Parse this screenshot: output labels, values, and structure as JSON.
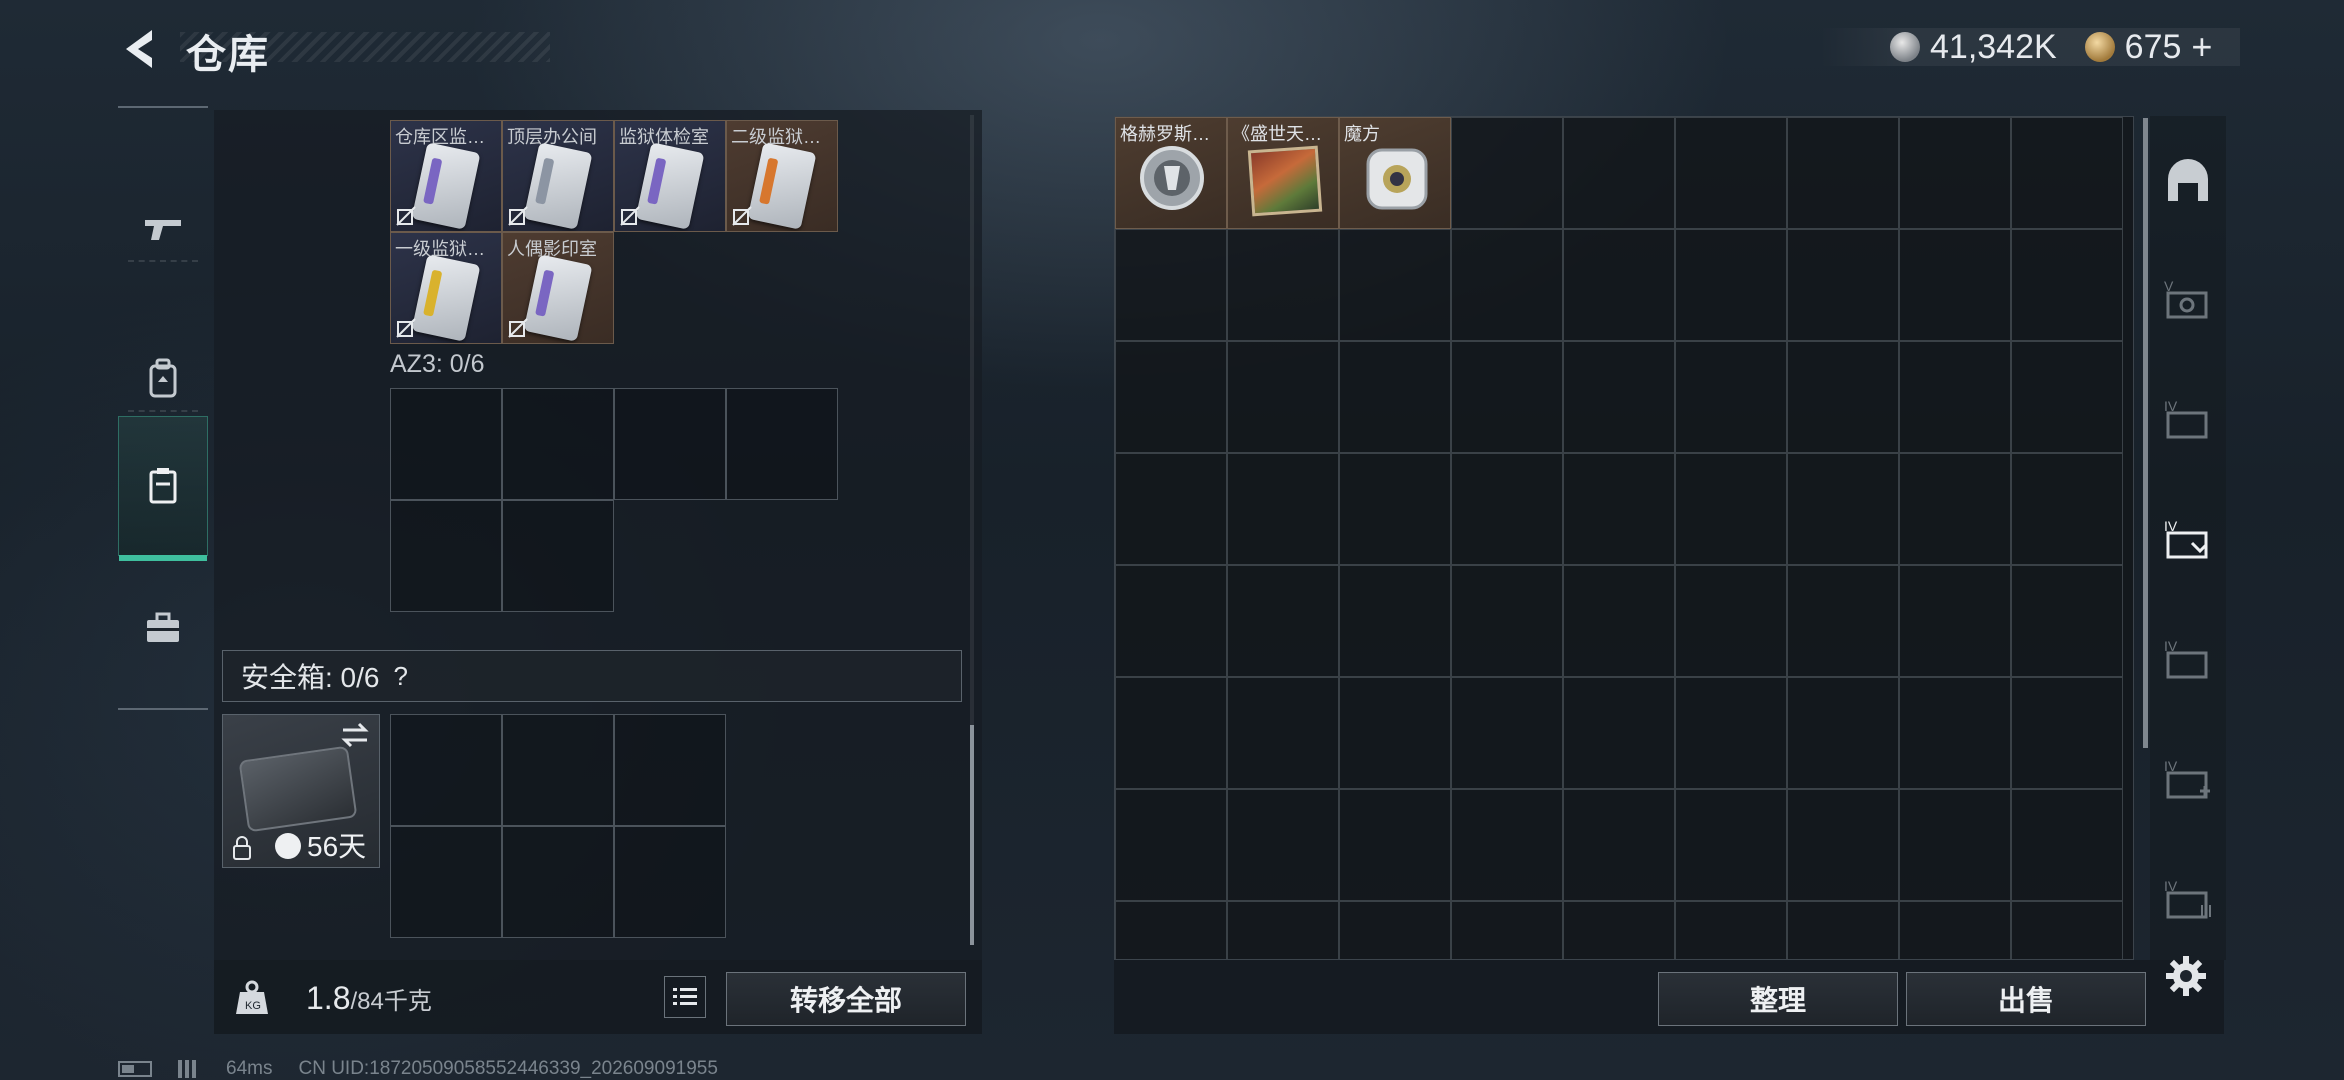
{
  "header": {
    "title": "仓库",
    "silver_amount": "41,342K",
    "gold_amount": "675",
    "gold_add": "+"
  },
  "left_nav": [
    "weapons-tab",
    "gear-tab",
    "storage-tab",
    "toolbox-tab"
  ],
  "keycards": [
    {
      "label": "仓库区监…",
      "accent": "purple",
      "bg": "blue"
    },
    {
      "label": "顶层办公间",
      "accent": "grey",
      "bg": "blue"
    },
    {
      "label": "监狱体检室",
      "accent": "purple",
      "bg": "blue"
    },
    {
      "label": "二级监狱…",
      "accent": "orange",
      "bg": "brown"
    },
    {
      "label": "一级监狱…",
      "accent": "yellow",
      "bg": "blue"
    },
    {
      "label": "人偶影印室",
      "accent": "purple",
      "bg": "brown"
    }
  ],
  "az3": {
    "label": "AZ3: 0/6"
  },
  "safe_box": {
    "label": "安全箱: 0/6",
    "help": "?",
    "days": "56天"
  },
  "weight": {
    "current": "1.8",
    "max": "/84千克"
  },
  "buttons": {
    "transfer_all": "转移全部",
    "organize": "整理",
    "sell": "出售"
  },
  "storage_items": [
    {
      "label": "格赫罗斯…"
    },
    {
      "label": "《盛世天…"
    },
    {
      "label": "魔方"
    }
  ],
  "status_bar": {
    "ping": "64ms",
    "uid": "CN UID:18720509058552446339_202609091955"
  }
}
